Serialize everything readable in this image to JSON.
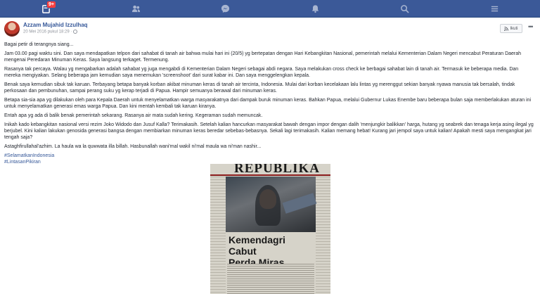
{
  "nav": {
    "notification_count": "9+",
    "icons": [
      "home-icon",
      "friends-icon",
      "messenger-icon",
      "notifications-icon",
      "search-icon",
      "menu-icon"
    ]
  },
  "post": {
    "author": "Azzam Mujahid Izzulhaq",
    "date": "20 Mei 2016 pukul 18:29 · ",
    "follow_label": "Ikuti",
    "paragraphs": [
      "Bagai petir di terangnya siang...",
      "Jam 03.00 pagi waktu sini. Dan saya mendapatkan telpon dari sahabat di tanah air bahwa mulai hari ini (20/5) yg bertepatan dengan Hari Kebangkitan Nasional, pemerintah melalui Kementerian Dalam Negeri mencabut Peraturan Daerah mengenai Peredaran Minuman Keras. Saya langsung terkaget. Termenung.",
      "Rasanya tak percaya. Walau yg mengabarkan adalah sahabat yg juga mengabdi di Kementerian Dalam Negeri sebagai abdi negara. Saya melakukan cross check ke berbagai sahabat lain di tanah air. Termasuk ke beberapa media. Dan mereka mengiyakan. Selang beberapa jam kemudian saya menemukan 'screenshoot' dari surat kabar ini. Dan saya menggelengkan kepala.",
      "Benak saya kemudian sibuk tak karuan. Terbayang betapa banyak korban akibat minuman keras di tanah air tercinta, Indonesia. Mulai dari korban kecelakaan lalu lintas yg merenggut sekian banyak nyawa manusia tak bersalah, tindak perkosaan dan pembunuhan, sampai perang suku yg kerap terjadi di Papua. Hampir semuanya berawal dari minuman keras.",
      "Betapa sia-sia apa yg dilakukan oleh para Kepala Daerah untuk menyelamatkan warga masyarakatnya dari dampak buruk minuman keras. Bahkan Papua, melalui Gubernur Lukas Enembe baru beberapa bulan saja memberlakukan aturan ini untuk menyelamatkan generasi emas warga Papua. Dan kini mentah kembali tak karuan kiranya.",
      "Entah apa yg ada di balik benak pemerintah sekarang. Rasanya air mata sudah kering. Kegeraman sudah memuncak.",
      "Inikah kado kebangkitan nasional versi rezim Joko Widodo dan Jusuf Kalla? Terimakasih. Setelah kalian hancurkan masyarakat bawah dengan impor dengan dalih 'menjungkir balikkan' harga, hutang yg seabrek dan tenaga kerja asing ilegal yg berjubel. Kini kalian lakukan genosida generasi bangsa dengan membiarkan minuman keras beredar sebebas-bebasnya. Sekali lagi terimakasih. Kalian memang hebat! Kurang jari jempol saya untuk kalian! Apakah mesti saya mengangkat jari tengah saja?",
      "Astaghfirullahal'azhim. La haula wa la quwwata illa billah. Hasbunallah wani'mal wakil ni'mal maula wa ni'man nashir..."
    ],
    "hashtags": [
      "#SelamatkanIndonesia",
      "#LintasanPikiran"
    ]
  },
  "newspaper": {
    "masthead": "REPUBLIKA",
    "headline_line1": "Kemendagri Cabut",
    "headline_line2": "Perda Miras"
  }
}
